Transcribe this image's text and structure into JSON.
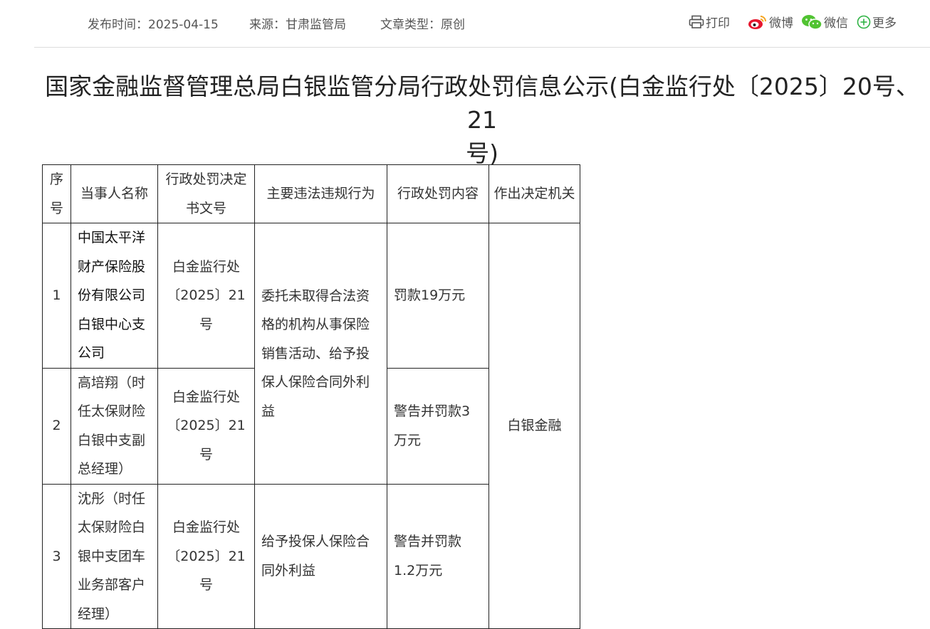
{
  "meta": {
    "publish_time": "发布时间：2025-04-15",
    "source": "来源：甘肃监管局",
    "article_type": "文章类型：原创"
  },
  "share": {
    "print": "打印",
    "weibo": "微博",
    "wechat": "微信",
    "more": "更多"
  },
  "article": {
    "title": "国家金融监督管理总局白银监管分局行政处罚信息公示(白金监行处〔2025〕20号、21\n号)"
  },
  "table": {
    "headers": {
      "no": "序号",
      "name": "当事人名称",
      "doc": "行政处罚决定书文号",
      "act": "主要违法违规行为",
      "penalty": "行政处罚内容",
      "authority": "作出决定机关"
    },
    "rows": [
      {
        "no": "1",
        "name": "中国太平洋财产保险股份有限公司白银中心支公司",
        "doc": "白金监行处〔2025〕21号",
        "penalty": "罚款19万元"
      },
      {
        "no": "2",
        "name": "高培翔（时任太保财险白银中支副总经理）",
        "doc": "白金监行处〔2025〕21号",
        "penalty": "警告并罚款3万元"
      },
      {
        "no": "3",
        "name": "沈彤（时任太保财险白银中支团车业务部客户经理）",
        "doc": "白金监行处〔2025〕21号",
        "act": "给予投保人保险合同外利益",
        "penalty": "警告并罚款1.2万元"
      }
    ],
    "shared_act_rows_1_2": "委托未取得合法资格的机构从事保险销售活动、给予投保人保险合同外利益",
    "authority": "白银金融"
  }
}
